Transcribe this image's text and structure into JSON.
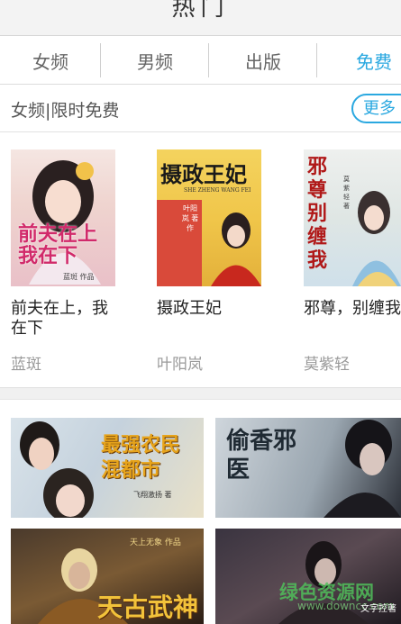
{
  "header": {
    "title": "热门"
  },
  "tabs": [
    {
      "label": "女频",
      "active": false
    },
    {
      "label": "男频",
      "active": false
    },
    {
      "label": "出版",
      "active": false
    },
    {
      "label": "免费",
      "active": true
    }
  ],
  "section": {
    "title": "女频|限时免费",
    "more_label": "更多"
  },
  "books": [
    {
      "title": "前夫在上，我在下",
      "author": "蓝斑",
      "cover_text": "前夫在上 我在下",
      "cover_caption": "蓝斑 作品"
    },
    {
      "title": "摄政王妃",
      "author": "叶阳岚",
      "cover_text": "摄政王妃",
      "cover_pinyin": "SHE ZHENG WANG FEI",
      "cover_caption": "叶阳岚 著作"
    },
    {
      "title": "邪尊，别缠我",
      "author": "莫紫轻",
      "cover_text": "邪尊 别缠我",
      "cover_caption": "莫紫轻 著"
    }
  ],
  "banners": [
    {
      "text": "最强农民混都市",
      "caption": "飞翔激扬 著"
    },
    {
      "text": "偷香邪医",
      "caption": ""
    },
    {
      "text": "天古武神",
      "caption": "天上无象 作品"
    },
    {
      "text": "",
      "caption": ""
    }
  ],
  "watermark": {
    "main": "绿色资源网",
    "sub": "www.downcc.com",
    "stamp": "文字控著"
  },
  "colors": {
    "accent": "#2aa8e0"
  }
}
